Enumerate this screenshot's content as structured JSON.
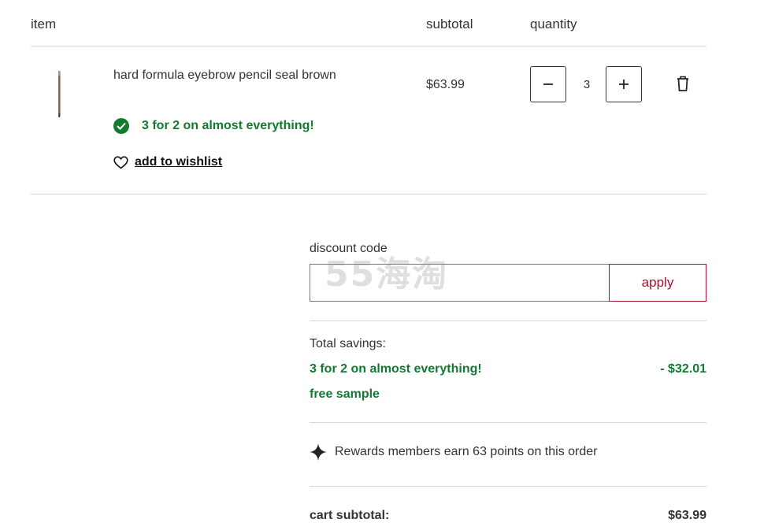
{
  "table_header": {
    "item": "item",
    "subtotal": "subtotal",
    "quantity": "quantity"
  },
  "product": {
    "name": "hard formula eyebrow pencil seal brown",
    "price": "$63.99",
    "quantity": "3",
    "promo_text": "3 for 2 on almost everything!",
    "wishlist_label": "add to wishlist"
  },
  "discount": {
    "label": "discount code",
    "input_value": "",
    "apply_label": "apply"
  },
  "watermark": "55海淘",
  "savings": {
    "title": "Total savings:",
    "promo_name": "3 for 2 on almost everything!",
    "promo_amount": "- $32.01",
    "free_sample": "free sample"
  },
  "rewards": {
    "text": "Rewards members earn 63 points on this order"
  },
  "cart": {
    "subtotal_label": "cart subtotal:",
    "subtotal_value": "$63.99"
  },
  "colors": {
    "promo_green": "#137a32",
    "apply_red": "#a50f2d"
  }
}
